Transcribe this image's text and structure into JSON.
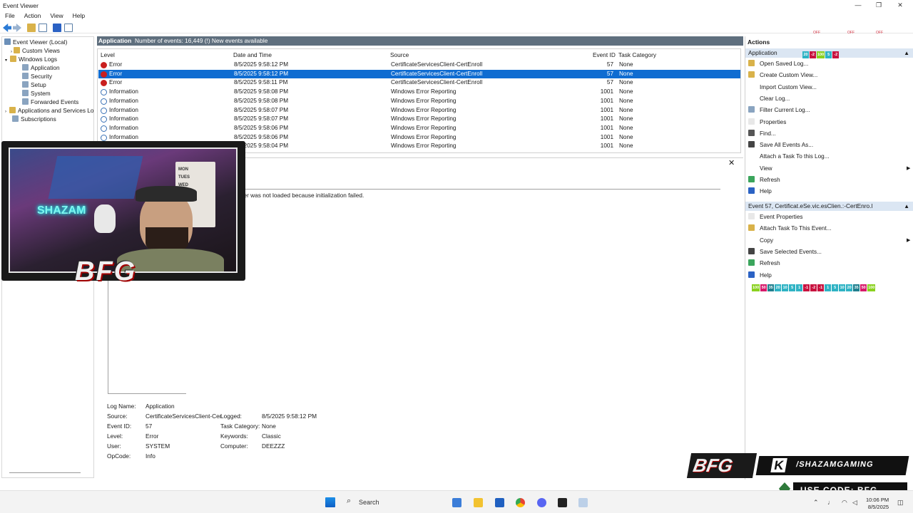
{
  "window": {
    "title": "Event Viewer",
    "controls": [
      "—",
      "❐",
      "✕"
    ]
  },
  "menu": [
    "File",
    "Action",
    "View",
    "Help"
  ],
  "tree": {
    "items": [
      {
        "label": "Event Viewer (Local)",
        "indent": 0,
        "icon_color": "#6b8fb8"
      },
      {
        "label": "Custom Views",
        "indent": 1,
        "icon_color": "#d9b24a"
      },
      {
        "label": "Windows Logs",
        "indent": 1,
        "icon_color": "#d9b24a"
      },
      {
        "label": "Application",
        "indent": 2,
        "icon_color": "#8aa4c0"
      },
      {
        "label": "Security",
        "indent": 2,
        "icon_color": "#8aa4c0"
      },
      {
        "label": "Setup",
        "indent": 2,
        "icon_color": "#8aa4c0"
      },
      {
        "label": "System",
        "indent": 2,
        "icon_color": "#8aa4c0"
      },
      {
        "label": "Forwarded Events",
        "indent": 2,
        "icon_color": "#8aa4c0"
      },
      {
        "label": "Applications and Services Lo",
        "indent": 1,
        "icon_color": "#d9b24a"
      },
      {
        "label": "Subscriptions",
        "indent": 1,
        "icon_color": "#8aa4c0"
      }
    ]
  },
  "center": {
    "log_name": "Application",
    "count_text": "Number of events: 16,449 (!) New events available",
    "columns": [
      "Level",
      "Date and Time",
      "Source",
      "Event ID",
      "Task Category"
    ],
    "rows": [
      {
        "level": "Error",
        "date": "8/5/2025 9:58:12 PM",
        "source": "CertificateServicesClient-CertEnroll",
        "id": "57",
        "task": "None",
        "type": "err",
        "selected": false
      },
      {
        "level": "Error",
        "date": "8/5/2025 9:58:12 PM",
        "source": "CertificateServicesClient-CertEnroll",
        "id": "57",
        "task": "None",
        "type": "err",
        "selected": true
      },
      {
        "level": "Error",
        "date": "8/5/2025 9:58:11 PM",
        "source": "CertificateServicesClient-CertEnroll",
        "id": "57",
        "task": "None",
        "type": "err",
        "selected": false
      },
      {
        "level": "Information",
        "date": "8/5/2025 9:58:08 PM",
        "source": "Windows Error Reporting",
        "id": "1001",
        "task": "None",
        "type": "inf",
        "selected": false
      },
      {
        "level": "Information",
        "date": "8/5/2025 9:58:08 PM",
        "source": "Windows Error Reporting",
        "id": "1001",
        "task": "None",
        "type": "inf",
        "selected": false
      },
      {
        "level": "Information",
        "date": "8/5/2025 9:58:07 PM",
        "source": "Windows Error Reporting",
        "id": "1001",
        "task": "None",
        "type": "inf",
        "selected": false
      },
      {
        "level": "Information",
        "date": "8/5/2025 9:58:07 PM",
        "source": "Windows Error Reporting",
        "id": "1001",
        "task": "None",
        "type": "inf",
        "selected": false
      },
      {
        "level": "Information",
        "date": "8/5/2025 9:58:06 PM",
        "source": "Windows Error Reporting",
        "id": "1001",
        "task": "None",
        "type": "inf",
        "selected": false
      },
      {
        "level": "Information",
        "date": "8/5/2025 9:58:06 PM",
        "source": "Windows Error Reporting",
        "id": "1001",
        "task": "None",
        "type": "inf",
        "selected": false
      },
      {
        "level": "Information",
        "date": "8/5/2025 9:58:04 PM",
        "source": "Windows Error Reporting",
        "id": "1001",
        "task": "None",
        "type": "inf",
        "selected": false
      }
    ]
  },
  "detail": {
    "message": "ider was not loaded because initialization failed.",
    "close": "✕",
    "fields": {
      "log_name_label": "Log Name:",
      "log_name": "Application",
      "source_label": "Source:",
      "source": "CertificateServicesClient-Cer",
      "logged_label": "Logged:",
      "logged": "8/5/2025 9:58:12 PM",
      "event_id_label": "Event ID:",
      "event_id": "57",
      "task_label": "Task Category:",
      "task": "None",
      "level_label": "Level:",
      "level": "Error",
      "keywords_label": "Keywords:",
      "keywords": "Classic",
      "user_label": "User:",
      "user": "SYSTEM",
      "computer_label": "Computer:",
      "computer": "DEEZZZ",
      "opcode_label": "OpCode:",
      "opcode": "Info"
    }
  },
  "actions": {
    "header": "Actions",
    "section1": "Application",
    "section1_items": [
      {
        "label": "Open Saved Log...",
        "icon": "folder-icon",
        "color": "#d9b24a",
        "sub": false
      },
      {
        "label": "Create Custom View...",
        "icon": "filter-icon",
        "color": "#d9b24a",
        "sub": false
      },
      {
        "label": "Import Custom View...",
        "icon": "import-icon",
        "color": "#ffffff",
        "sub": false
      },
      {
        "label": "Clear Log...",
        "icon": "blank-icon",
        "color": "#ffffff",
        "sub": false
      },
      {
        "label": "Filter Current Log...",
        "icon": "filter-icon",
        "color": "#8aa4c0",
        "sub": false
      },
      {
        "label": "Properties",
        "icon": "properties-icon",
        "color": "#e8e8e8",
        "sub": false
      },
      {
        "label": "Find...",
        "icon": "binoculars-icon",
        "color": "#555555",
        "sub": false
      },
      {
        "label": "Save All Events As...",
        "icon": "save-icon",
        "color": "#444444",
        "sub": false
      },
      {
        "label": "Attach a Task To this Log...",
        "icon": "blank-icon",
        "color": "#ffffff",
        "sub": false
      },
      {
        "label": "View",
        "icon": "blank-icon",
        "color": "#ffffff",
        "sub": true
      },
      {
        "label": "Refresh",
        "icon": "refresh-icon",
        "color": "#3ba55c",
        "sub": false
      },
      {
        "label": "Help",
        "icon": "help-icon",
        "color": "#2b62c4",
        "sub": false
      }
    ],
    "section2": "Event 57, Certificat.eSe.vic.esClien.:-CertEnro.l",
    "section2_items": [
      {
        "label": "Event Properties",
        "icon": "properties-icon",
        "color": "#e8e8e8",
        "sub": false
      },
      {
        "label": "Attach Task To This Event...",
        "icon": "task-icon",
        "color": "#d9b24a",
        "sub": false
      },
      {
        "label": "Copy",
        "icon": "blank-icon",
        "color": "#ffffff",
        "sub": true
      },
      {
        "label": "Save Selected Events...",
        "icon": "save-icon",
        "color": "#444444",
        "sub": false
      },
      {
        "label": "Refresh",
        "icon": "refresh-icon",
        "color": "#3ba55c",
        "sub": false
      },
      {
        "label": "Help",
        "icon": "help-icon",
        "color": "#2b62c4",
        "sub": false
      }
    ],
    "section_arrow": "▲",
    "submenu_arrow": "▶"
  },
  "overlays": {
    "top_chips": [
      {
        "t": "20",
        "c": "#2fb3c4"
      },
      {
        "t": "-2",
        "c": "#c8123f"
      },
      {
        "t": "100",
        "c": "#8ad11f"
      },
      {
        "t": "5",
        "c": "#2fb3c4"
      },
      {
        "t": "-2",
        "c": "#c8123f"
      }
    ],
    "bottom_chips": [
      {
        "t": "100",
        "c": "#8ad11f"
      },
      {
        "t": "50",
        "c": "#d61a6a"
      },
      {
        "t": "35",
        "c": "#1f7f8e"
      },
      {
        "t": "20",
        "c": "#2fb3c4"
      },
      {
        "t": "10",
        "c": "#2fb3c4"
      },
      {
        "t": "5",
        "c": "#2fb3c4"
      },
      {
        "t": "1",
        "c": "#2fb3c4"
      },
      {
        "t": "-1",
        "c": "#c8123f"
      },
      {
        "t": "-2",
        "c": "#c8123f"
      },
      {
        "t": "-1",
        "c": "#c8123f"
      },
      {
        "t": "1",
        "c": "#2fb3c4"
      },
      {
        "t": "5",
        "c": "#2fb3c4"
      },
      {
        "t": "10",
        "c": "#2fb3c4"
      },
      {
        "t": "20",
        "c": "#2fb3c4"
      },
      {
        "t": "35",
        "c": "#1f7f8e"
      },
      {
        "t": "50",
        "c": "#d61a6a"
      },
      {
        "t": "100",
        "c": "#8ad11f"
      }
    ],
    "top_status": [
      "OFF",
      "OFF",
      "OFF"
    ],
    "cam_logo": "BFG",
    "brand_logo": "BFG",
    "kick_handle": "/SHAZAMGAMING",
    "kick_letter": "K",
    "promo": "USE CODE: BFG",
    "neon_sign": "SHAZAM",
    "whiteboard_lines": [
      "MON",
      "TUES",
      "WED",
      "THURS",
      "FRI",
      "SAT",
      "SUN"
    ]
  },
  "taskbar": {
    "search_placeholder": "Search",
    "clock_time": "10:06 PM",
    "clock_date": "8/5/2025"
  }
}
